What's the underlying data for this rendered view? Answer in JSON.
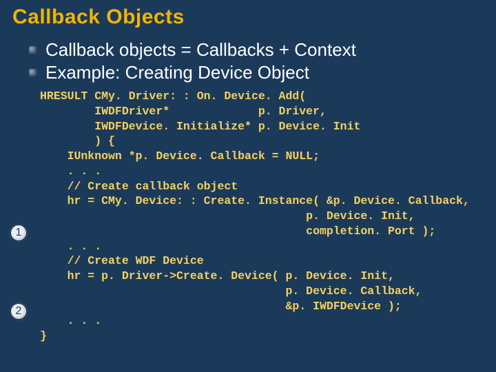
{
  "title": "Callback Objects",
  "bullets": [
    "Callback objects = Callbacks + Context",
    "Example: Creating Device Object"
  ],
  "code": "HRESULT CMy. Driver: : On. Device. Add(\n        IWDFDriver*             p. Driver,\n        IWDFDevice. Initialize* p. Device. Init\n        ) {\n    IUnknown *p. Device. Callback = NULL;\n    . . .\n    // Create callback object\n    hr = CMy. Device: : Create. Instance( &p. Device. Callback,\n                                       p. Device. Init,\n                                       completion. Port );\n    . . .\n    // Create WDF Device\n    hr = p. Driver->Create. Device( p. Device. Init,\n                                    p. Device. Callback,\n                                    &p. IWDFDevice );\n    . . .\n}",
  "markers": {
    "one": "1",
    "two": "2"
  }
}
